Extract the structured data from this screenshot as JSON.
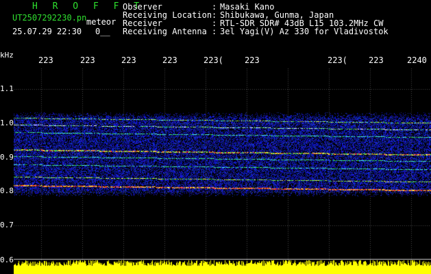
{
  "header": {
    "brand": "H R O F F T",
    "filename": "UT2507292230.pn",
    "mode": "meteor",
    "datetime": "25.07.29 22:30",
    "extra": "0__",
    "info": [
      {
        "label": "Observer",
        "value": "Masaki Kano"
      },
      {
        "label": "Receiving Location",
        "value": "Shibukawa, Gunma, Japan"
      },
      {
        "label": "Receiver",
        "value": "RTL-SDR SDR# 43dB L15 103.2MHz CW"
      },
      {
        "label": "Receiving Antenna",
        "value": "3el Yagi(V) Az 330 for Vladivostok"
      }
    ]
  },
  "axes": {
    "y_unit": "kHz",
    "y_ticks": [
      "1.1",
      "1.0",
      "0.9",
      "0.8",
      "0.7",
      "0.6"
    ],
    "x_ticks": [
      "223",
      "223",
      "223",
      "223",
      "223(",
      "223",
      "223(",
      "223",
      "2240"
    ]
  },
  "colors": {
    "background": "#000000",
    "header_green": "#2fe02f",
    "noise_blue": "#1f2fd0",
    "signal_red": "#ff2a2a",
    "signal_green": "#30e050",
    "meter_yellow": "#ffff00"
  }
}
